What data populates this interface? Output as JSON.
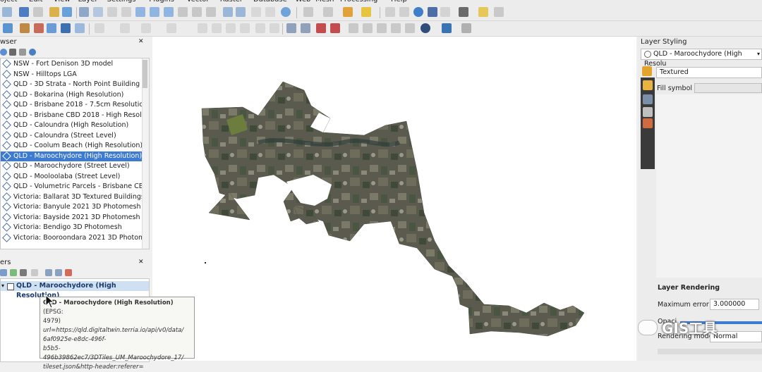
{
  "menu": [
    "oject",
    "Edit",
    "View",
    "Layer",
    "Settings",
    "Plugins",
    "Vector",
    "Raster",
    "Database",
    "Web",
    "Mesh",
    "Processing",
    "Help"
  ],
  "browser": {
    "title": "wser",
    "items": [
      {
        "label": "NSW - Fort Denison 3D model"
      },
      {
        "label": "NSW - Hilltops LGA"
      },
      {
        "label": "QLD - 3D Strata - North Point Building"
      },
      {
        "label": "QLD - Bokarina (High Resolution)"
      },
      {
        "label": "QLD - Brisbane 2018 - 7.5cm Resolution"
      },
      {
        "label": "QLD - Brisbane CBD 2018 - High Resolution"
      },
      {
        "label": "QLD - Caloundra (High Resolution)"
      },
      {
        "label": "QLD - Caloundra (Street Level)"
      },
      {
        "label": "QLD - Coolum Beach (High Resolution)"
      },
      {
        "label": "QLD - Maroochydore (High Resolution)"
      },
      {
        "label": "QLD - Maroochydore (Street Level)"
      },
      {
        "label": "QLD - Mooloolaba (Street Level)"
      },
      {
        "label": "QLD - Volumetric Parcels - Brisbane CBD"
      },
      {
        "label": "Victoria: Ballarat 3D Textured Buildings"
      },
      {
        "label": "Victoria: Banyule 2021 3D Photomesh"
      },
      {
        "label": "Victoria: Bayside 2021 3D Photomesh"
      },
      {
        "label": "Victoria: Bendigo 3D Photomesh"
      },
      {
        "label": "Victoria: Booroondara 2021 3D Photomesh"
      }
    ],
    "selected_index": 9
  },
  "layers": {
    "title": "ers",
    "items": [
      {
        "label": "QLD - Maroochydore (High Resolution)"
      }
    ]
  },
  "tooltip": {
    "name": "QLD - Maroochydore (High Resolution)",
    "crs": " (EPSG:",
    "crs2": "4979)",
    "url_lines": [
      "url=https://qld.digitaltwin.terria.io/api/v0/data/",
      "6af0925e-e8dc-496f-",
      "b5b5-496b39862ec7/3DTiles_UM_Maroochydore_17/",
      "tileset.json&http-header:referer="
    ]
  },
  "styling": {
    "title": "Layer Styling",
    "layer_select": "QLD - Maroochydore (High Resolu",
    "renderer": "Textured",
    "fill_symbol_label": "Fill symbol",
    "section_title": "Layer Rendering",
    "max_error_label": "Maximum error",
    "max_error_value": "3.000000",
    "opacity_label": "Opaci",
    "rendering_mode_label": "Rendering mode",
    "rendering_mode_value": "Normal"
  },
  "watermark": "GIS工具",
  "colors": {
    "selection": "#3d7ad1",
    "panel_bg": "#ffffff",
    "chrome": "#ececec"
  }
}
